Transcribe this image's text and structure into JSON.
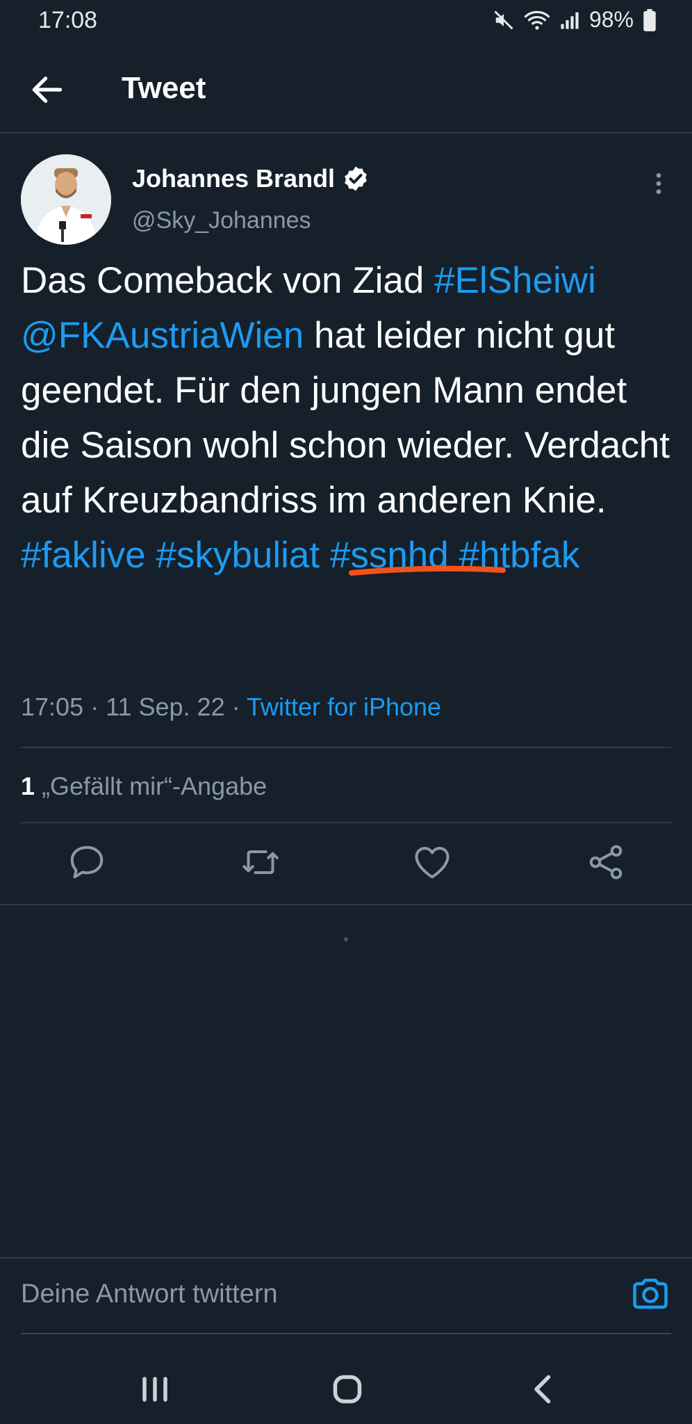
{
  "status_bar": {
    "time": "17:08",
    "battery": "98%"
  },
  "header": {
    "title": "Tweet"
  },
  "tweet": {
    "author_name": "Johannes Brandl",
    "handle": "@Sky_Johannes",
    "text_1": "Das Comeback von Ziad",
    "hashtag_elsheiwi": "#ElSheiwi",
    "mention_fkaustria": "@FKAustriaWien",
    "text_2": "hat leider nicht gut geendet. Für den jungen Mann endet die Saison wohl schon wieder. Verdacht auf Kreuzbandriss im anderen Knie.",
    "hashtag_faklive": "#faklive",
    "hashtag_skybuliat": "#skybuliat",
    "hashtag_ssnhd": "#ssnhd",
    "hashtag_htbfak": "#htbfak",
    "time": "17:05",
    "date": "11 Sep. 22",
    "source": "Twitter for iPhone",
    "likes_count": "1",
    "likes_label": "„Gefällt mir“-Angabe"
  },
  "reply": {
    "placeholder": "Deine Antwort twittern"
  },
  "colors": {
    "background": "#15202b",
    "accent": "#1d9bf0",
    "secondary_text": "#8b98a5",
    "annotation": "#f4511e"
  },
  "icons": [
    "back-arrow-icon",
    "verified-badge-icon",
    "more-vertical-icon",
    "reply-icon",
    "retweet-icon",
    "like-icon",
    "share-icon",
    "camera-icon",
    "recent-apps-icon",
    "home-icon",
    "back-icon"
  ]
}
